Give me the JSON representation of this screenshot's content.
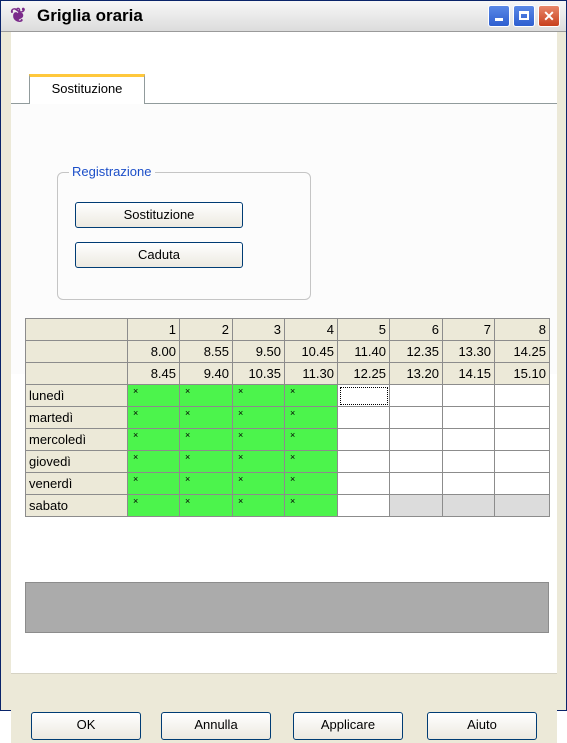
{
  "window": {
    "title": "Griglia oraria"
  },
  "tabs": [
    {
      "label": "Sostituzione"
    }
  ],
  "group": {
    "legend": "Registrazione",
    "buttons": [
      {
        "label": "Sostituzione"
      },
      {
        "label": "Caduta"
      }
    ]
  },
  "grid": {
    "periods": [
      "1",
      "2",
      "3",
      "4",
      "5",
      "6",
      "7",
      "8"
    ],
    "start_times": [
      "8.00",
      "8.55",
      "9.50",
      "10.45",
      "11.40",
      "12.35",
      "13.30",
      "14.25"
    ],
    "end_times": [
      "8.45",
      "9.40",
      "10.35",
      "11.30",
      "12.25",
      "13.20",
      "14.15",
      "15.10"
    ],
    "days": [
      {
        "name": "lunedì",
        "slots": [
          "×",
          "×",
          "×",
          "×",
          "",
          "",
          "",
          ""
        ]
      },
      {
        "name": "martedì",
        "slots": [
          "×",
          "×",
          "×",
          "×",
          "",
          "",
          "",
          ""
        ]
      },
      {
        "name": "mercoledì",
        "slots": [
          "×",
          "×",
          "×",
          "×",
          "",
          "",
          "",
          ""
        ]
      },
      {
        "name": "giovedì",
        "slots": [
          "×",
          "×",
          "×",
          "×",
          "",
          "",
          "",
          ""
        ]
      },
      {
        "name": "venerdì",
        "slots": [
          "×",
          "×",
          "×",
          "×",
          "",
          "",
          "",
          ""
        ]
      },
      {
        "name": "sabato",
        "slots": [
          "×",
          "×",
          "×",
          "×",
          "",
          "",
          "",
          ""
        ]
      }
    ],
    "active_color": "#4cf44c"
  },
  "footer": {
    "ok_label": "OK",
    "cancel_label": "Annulla",
    "apply_label": "Applicare",
    "help_label": "Aiuto"
  },
  "icons": {
    "app": "app-icon",
    "minimize": "minimize-icon",
    "maximize": "maximize-icon",
    "close": "close-icon"
  }
}
